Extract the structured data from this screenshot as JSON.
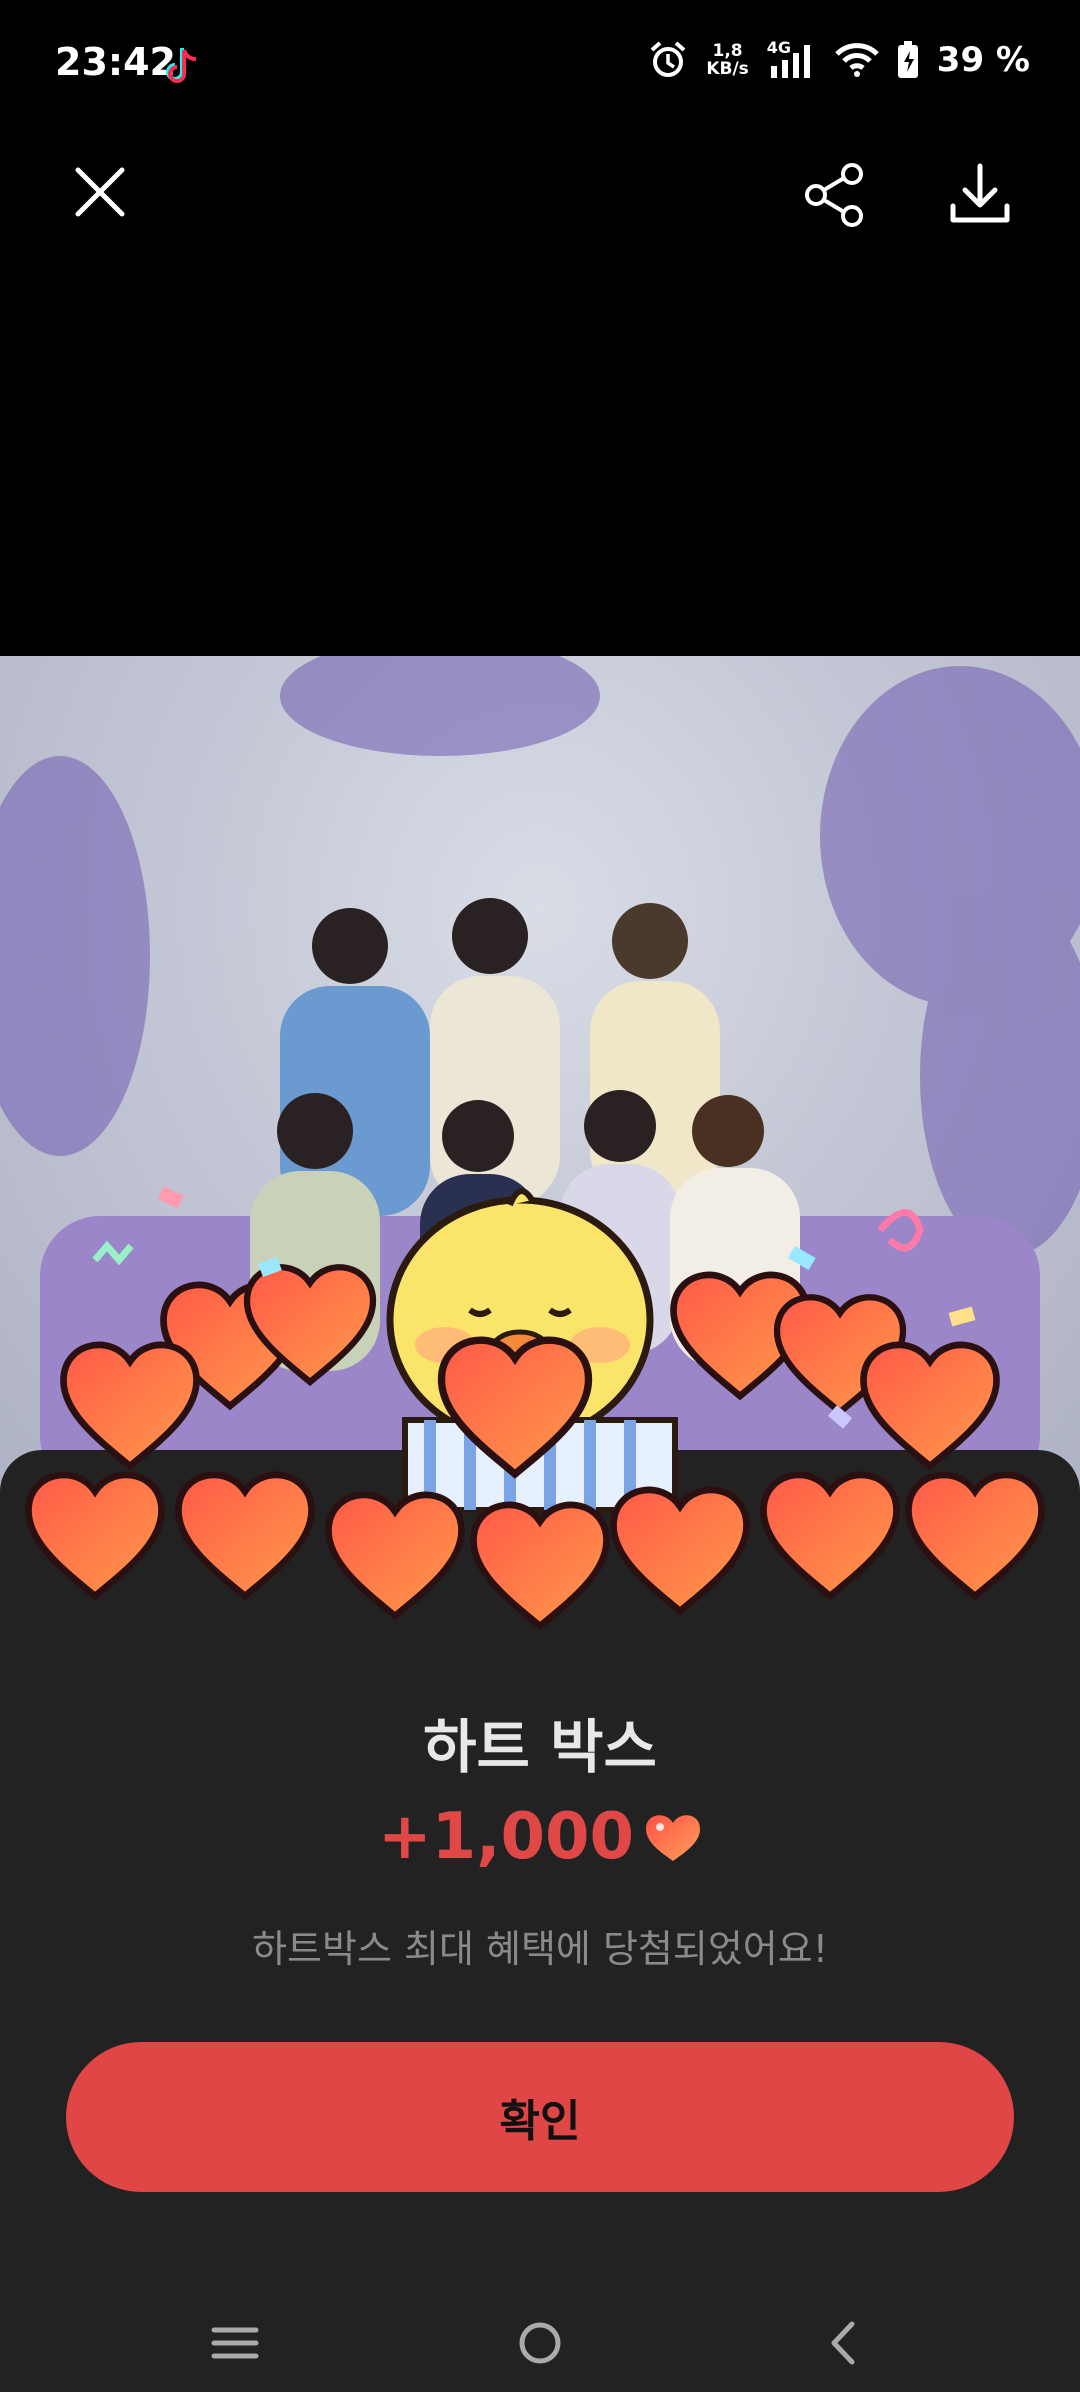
{
  "status_bar": {
    "time": "23:42",
    "net_speed_value": "1,8",
    "net_speed_unit": "KB/s",
    "network_type": "4G",
    "battery": "39 %",
    "icons": [
      "tiktok-icon",
      "alarm-icon",
      "signal-icon",
      "wifi-icon",
      "battery-icon"
    ]
  },
  "top_bar": {
    "icons": [
      "close-icon",
      "share-icon",
      "download-icon"
    ]
  },
  "reward": {
    "title": "하트 박스",
    "amount": "+1,000",
    "message": "하트박스 최대 혜택에 당첨되었어요!",
    "confirm_label": "확인"
  },
  "nav_bar": {
    "icons": [
      "menu-icon",
      "home-icon",
      "back-icon"
    ]
  },
  "colors": {
    "accent": "#e04646",
    "sheet_bg": "#222222",
    "screen_bg": "#000000"
  }
}
